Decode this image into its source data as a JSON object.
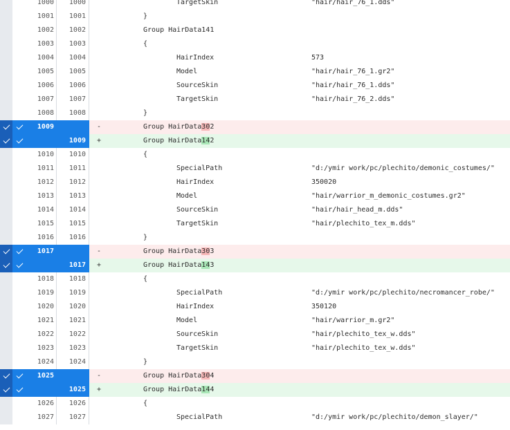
{
  "rows": [
    {
      "type": "ctx",
      "ln1": "1000",
      "ln2": "1000",
      "indent": 2,
      "code": "TargetSkin",
      "value": "\"hair/hair_76_1.dds\""
    },
    {
      "type": "ctx",
      "ln1": "1001",
      "ln2": "1001",
      "indent": 1,
      "code": "}",
      "value": ""
    },
    {
      "type": "ctx",
      "ln1": "1002",
      "ln2": "1002",
      "indent": 1,
      "code": "Group HairData141",
      "value": ""
    },
    {
      "type": "ctx",
      "ln1": "1003",
      "ln2": "1003",
      "indent": 1,
      "code": "{",
      "value": ""
    },
    {
      "type": "ctx",
      "ln1": "1004",
      "ln2": "1004",
      "indent": 2,
      "code": "HairIndex",
      "value": "573"
    },
    {
      "type": "ctx",
      "ln1": "1005",
      "ln2": "1005",
      "indent": 2,
      "code": "Model",
      "value": "\"hair/hair_76_1.gr2\""
    },
    {
      "type": "ctx",
      "ln1": "1006",
      "ln2": "1006",
      "indent": 2,
      "code": "SourceSkin",
      "value": "\"hair/hair_76_1.dds\""
    },
    {
      "type": "ctx",
      "ln1": "1007",
      "ln2": "1007",
      "indent": 2,
      "code": "TargetSkin",
      "value": "\"hair/hair_76_2.dds\""
    },
    {
      "type": "ctx",
      "ln1": "1008",
      "ln2": "1008",
      "indent": 1,
      "code": "}",
      "value": ""
    },
    {
      "type": "del",
      "ln1": "1009",
      "ln2": "",
      "sign": "-",
      "indent": 1,
      "code_pre": "Group HairData",
      "code_hl": "30",
      "code_post": "2"
    },
    {
      "type": "add",
      "ln1": "",
      "ln2": "1009",
      "sign": "+",
      "indent": 1,
      "code_pre": "Group HairData",
      "code_hl": "14",
      "code_post": "2"
    },
    {
      "type": "ctx",
      "ln1": "1010",
      "ln2": "1010",
      "indent": 1,
      "code": "{",
      "value": ""
    },
    {
      "type": "ctx",
      "ln1": "1011",
      "ln2": "1011",
      "indent": 2,
      "code": "SpecialPath",
      "value": "\"d:/ymir work/pc/plechito/demonic_costumes/\""
    },
    {
      "type": "ctx",
      "ln1": "1012",
      "ln2": "1012",
      "indent": 2,
      "code": "HairIndex",
      "value": "350020"
    },
    {
      "type": "ctx",
      "ln1": "1013",
      "ln2": "1013",
      "indent": 2,
      "code": "Model",
      "value": "\"hair/warrior_m_demonic_costumes.gr2\""
    },
    {
      "type": "ctx",
      "ln1": "1014",
      "ln2": "1014",
      "indent": 2,
      "code": "SourceSkin",
      "value": "\"hair/hair_head_m.dds\""
    },
    {
      "type": "ctx",
      "ln1": "1015",
      "ln2": "1015",
      "indent": 2,
      "code": "TargetSkin",
      "value": "\"hair/plechito_tex_m.dds\""
    },
    {
      "type": "ctx",
      "ln1": "1016",
      "ln2": "1016",
      "indent": 1,
      "code": "}",
      "value": ""
    },
    {
      "type": "del",
      "ln1": "1017",
      "ln2": "",
      "sign": "-",
      "indent": 1,
      "code_pre": "Group HairData",
      "code_hl": "30",
      "code_post": "3"
    },
    {
      "type": "add",
      "ln1": "",
      "ln2": "1017",
      "sign": "+",
      "indent": 1,
      "code_pre": "Group HairData",
      "code_hl": "14",
      "code_post": "3"
    },
    {
      "type": "ctx",
      "ln1": "1018",
      "ln2": "1018",
      "indent": 1,
      "code": "{",
      "value": ""
    },
    {
      "type": "ctx",
      "ln1": "1019",
      "ln2": "1019",
      "indent": 2,
      "code": "SpecialPath",
      "value": "\"d:/ymir work/pc/plechito/necromancer_robe/\""
    },
    {
      "type": "ctx",
      "ln1": "1020",
      "ln2": "1020",
      "indent": 2,
      "code": "HairIndex",
      "value": "350120"
    },
    {
      "type": "ctx",
      "ln1": "1021",
      "ln2": "1021",
      "indent": 2,
      "code": "Model",
      "value": "\"hair/warrior_m.gr2\""
    },
    {
      "type": "ctx",
      "ln1": "1022",
      "ln2": "1022",
      "indent": 2,
      "code": "SourceSkin",
      "value": "\"hair/plechito_tex_w.dds\""
    },
    {
      "type": "ctx",
      "ln1": "1023",
      "ln2": "1023",
      "indent": 2,
      "code": "TargetSkin",
      "value": "\"hair/plechito_tex_w.dds\""
    },
    {
      "type": "ctx",
      "ln1": "1024",
      "ln2": "1024",
      "indent": 1,
      "code": "}",
      "value": ""
    },
    {
      "type": "del",
      "ln1": "1025",
      "ln2": "",
      "sign": "-",
      "indent": 1,
      "code_pre": "Group HairData",
      "code_hl": "30",
      "code_post": "4"
    },
    {
      "type": "add",
      "ln1": "",
      "ln2": "1025",
      "sign": "+",
      "indent": 1,
      "code_pre": "Group HairData",
      "code_hl": "14",
      "code_post": "4"
    },
    {
      "type": "ctx",
      "ln1": "1026",
      "ln2": "1026",
      "indent": 1,
      "code": "{",
      "value": ""
    },
    {
      "type": "ctx",
      "ln1": "1027",
      "ln2": "1027",
      "indent": 2,
      "code": "SpecialPath",
      "value": "\"d:/ymir work/pc/plechito/demon_slayer/\""
    }
  ]
}
